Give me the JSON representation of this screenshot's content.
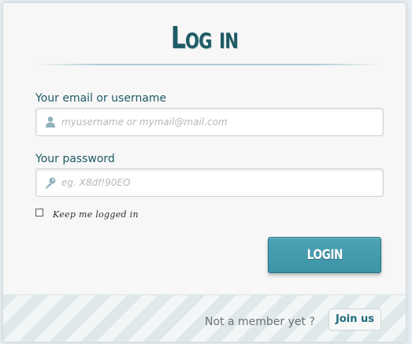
{
  "form": {
    "title": "Log in",
    "username": {
      "label": "Your email or username",
      "placeholder": "myusername or mymail@mail.com",
      "icon": "user-icon"
    },
    "password": {
      "label": "Your password",
      "placeholder": "eg. X8df!90EO",
      "icon": "key-icon"
    },
    "remember": {
      "label": "Keep me logged in",
      "checked": false
    },
    "submit_label": "LOGIN"
  },
  "footer": {
    "prompt": "Not a member yet ?",
    "join_label": "Join us"
  },
  "colors": {
    "accent": "#3b94a6",
    "title": "#1f5a64"
  }
}
